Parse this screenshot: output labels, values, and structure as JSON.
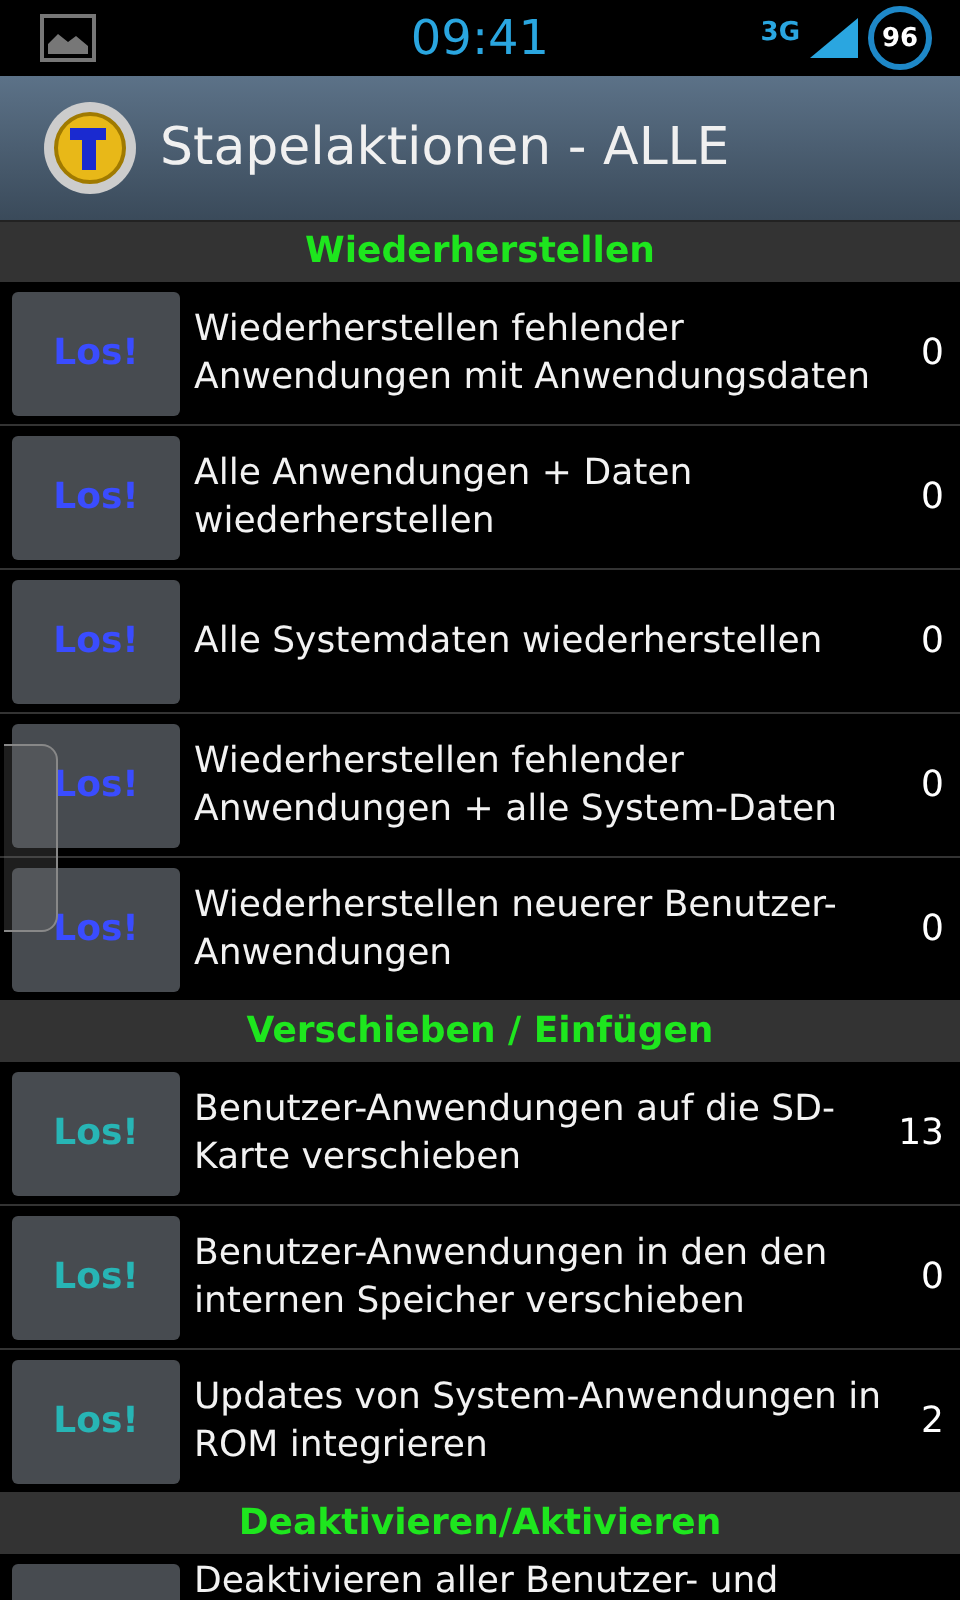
{
  "status_bar": {
    "time": "09:41",
    "network": "3G",
    "battery": "96"
  },
  "action_bar": {
    "title": "Stapelaktionen - ALLE"
  },
  "sections": [
    {
      "title": "Wiederherstellen",
      "kind": "restore",
      "rows": [
        {
          "button": "Los!",
          "label": "Wiederherstellen fehlender Anwendungen mit Anwendungsdaten",
          "count": "0"
        },
        {
          "button": "Los!",
          "label": "Alle Anwendungen + Daten wiederherstellen",
          "count": "0"
        },
        {
          "button": "Los!",
          "label": "Alle Systemdaten wiederherstellen",
          "count": "0"
        },
        {
          "button": "Los!",
          "label": "Wiederherstellen fehlender Anwendungen + alle System-Daten",
          "count": "0"
        },
        {
          "button": "Los!",
          "label": "Wiederherstellen neuerer Benutzer-Anwendungen",
          "count": "0"
        }
      ]
    },
    {
      "title": "Verschieben / Einfügen",
      "kind": "move",
      "rows": [
        {
          "button": "Los!",
          "label": "Benutzer-Anwendungen auf die SD-Karte verschieben",
          "count": "13"
        },
        {
          "button": "Los!",
          "label": "Benutzer-Anwendungen in den den internen Speicher verschieben",
          "count": "0"
        },
        {
          "button": "Los!",
          "label": "Updates von System-Anwendungen in ROM integrieren",
          "count": "2"
        }
      ]
    },
    {
      "title": "Deaktivieren/Aktivieren",
      "rows": [
        {
          "label": "Deaktivieren aller Benutzer- und"
        }
      ]
    }
  ]
}
